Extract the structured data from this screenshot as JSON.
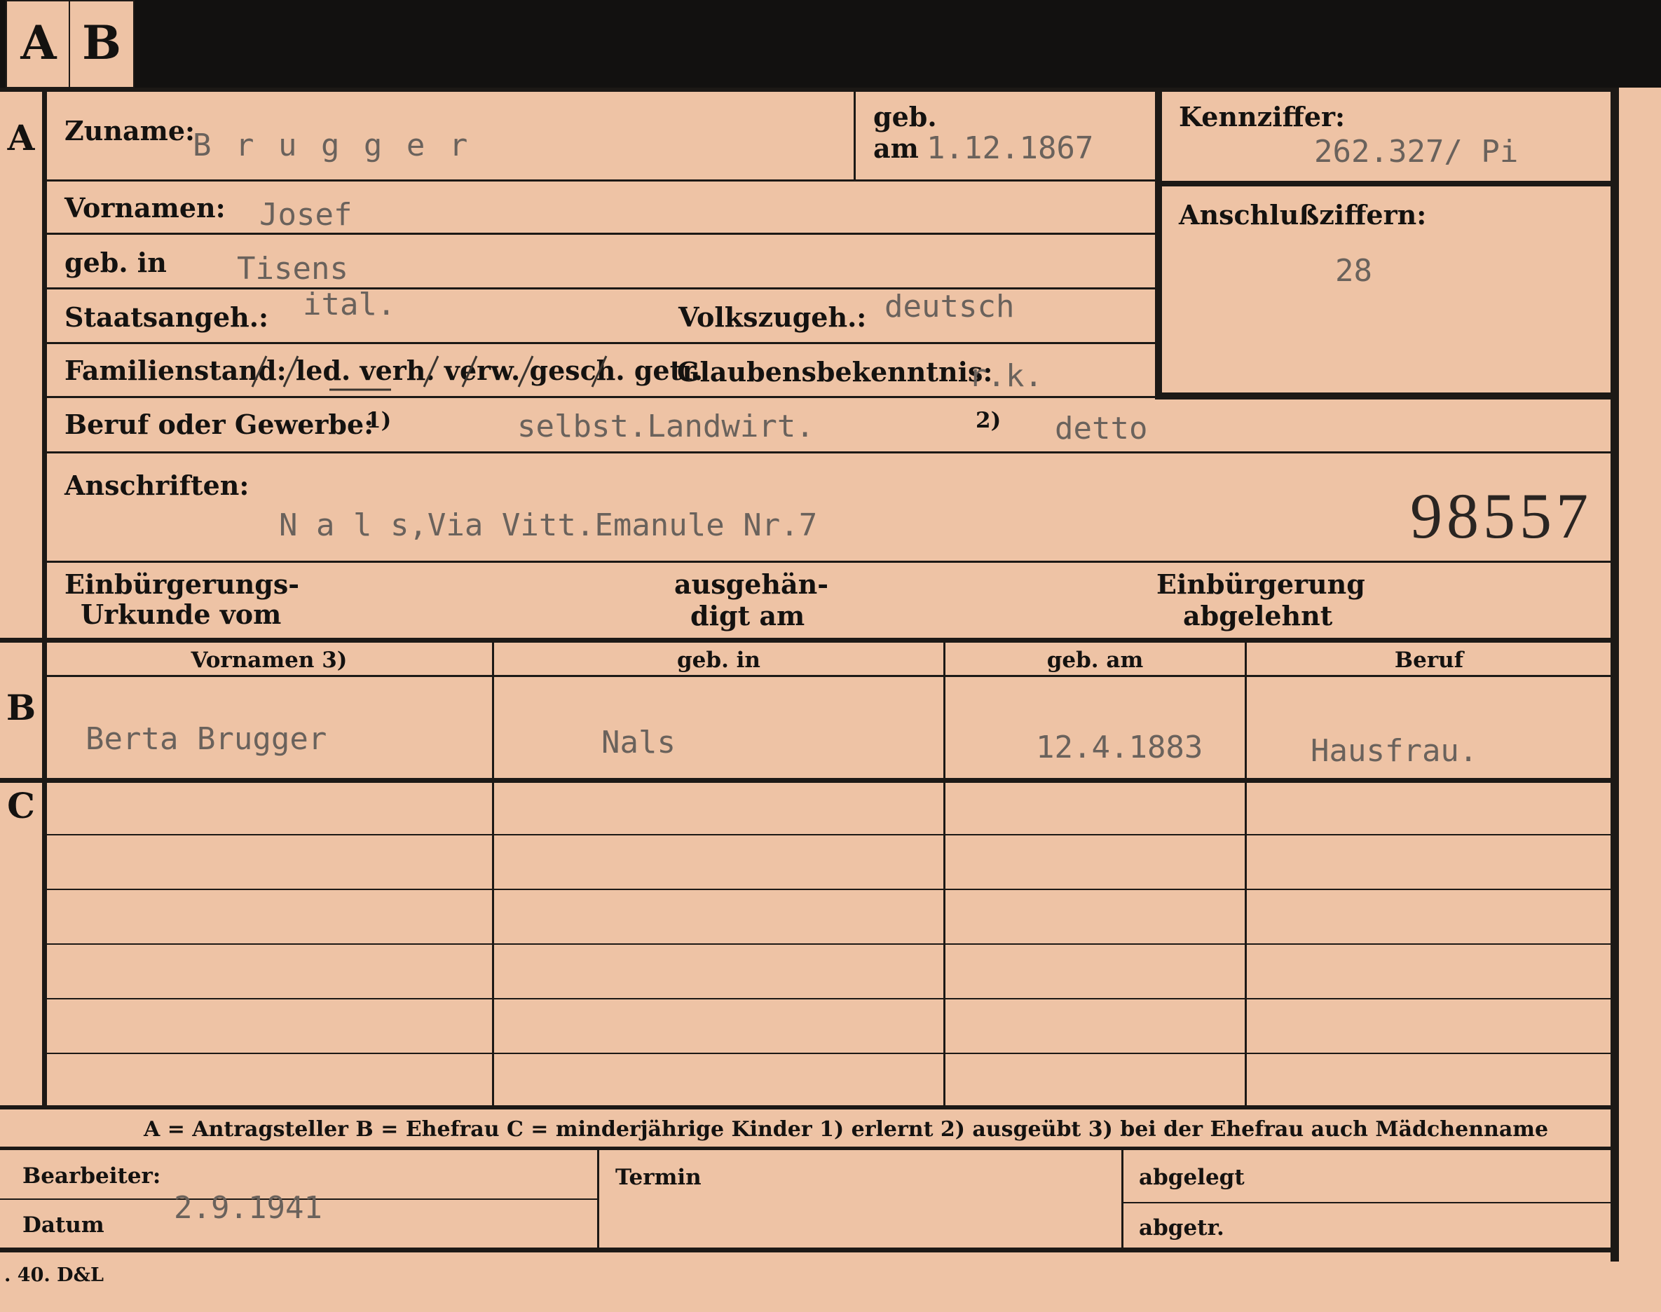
{
  "tabs": [
    "A",
    "B"
  ],
  "section_markers": {
    "a": "A",
    "b": "B",
    "c": "C"
  },
  "section_a": {
    "surname_label": "Zuname:",
    "surname_value": "B r u g g e r",
    "born_label_1": "geb.",
    "born_label_2": "am",
    "born_value": "1.12.1867",
    "kennziffer_label": "Kennziffer:",
    "kennziffer_value": "262.327/ Pi",
    "anschluss_label": "Anschlußziffern:",
    "anschluss_value": "28",
    "vornamen_label": "Vornamen:",
    "vornamen_value": "Josef",
    "geb_in_label": "geb. in",
    "geb_in_value": "Tisens",
    "staatsangeh_label": "Staatsangeh.:",
    "staatsangeh_value": "ital.",
    "volkszugeh_label": "Volkszugeh.:",
    "volkszugeh_value": "deutsch",
    "familienstand_label": "Familienstand: led. verh. verw. gesch. getr.",
    "glaubens_label": "Glaubensbekenntnis:",
    "glaubens_value": "r.k.",
    "beruf_label": "Beruf oder Gewerbe:",
    "beruf_note1": "1)",
    "beruf_value1": "selbst.Landwirt.",
    "beruf_note2": "2)",
    "beruf_value2": "detto",
    "anschriften_label": "Anschriften:",
    "anschriften_value": "N a l s,Via Vitt.Emanule Nr.7",
    "card_number": "98557",
    "einb_urkunde_1": "Einbürgerungs-",
    "einb_urkunde_2": "Urkunde vom",
    "ausgehaendigt_1": "ausgehän-",
    "ausgehaendigt_2": "digt am",
    "einb_abgelehnt_1": "Einbürgerung",
    "einb_abgelehnt_2": "abgelehnt"
  },
  "section_b": {
    "headers": [
      "Vornamen 3)",
      "geb. in",
      "geb. am",
      "Beruf"
    ],
    "row": [
      "Berta Brugger",
      "Nals",
      "12.4.1883",
      "Hausfrau."
    ]
  },
  "legend": "A = Antragsteller   B = Ehefrau   C = minderjährige Kinder   1) erlernt   2) ausgeübt   3) bei der Ehefrau auch Mädchenname",
  "footer": {
    "bearbeiter_label": "Bearbeiter:",
    "datum_label": "Datum",
    "datum_value": "2.9.1941",
    "termin_label": "Termin",
    "abgelegt_label": "abgelegt",
    "abgetr_label": "abgetr."
  },
  "printer_mark": ". 40. D&L"
}
